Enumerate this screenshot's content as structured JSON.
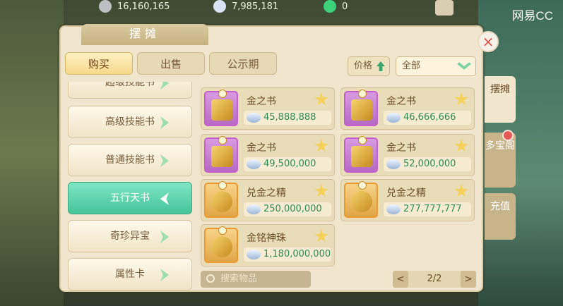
{
  "top_bar": {
    "resources": [
      {
        "icon": "coin-icon",
        "value": "16,160,165"
      },
      {
        "icon": "silver-icon",
        "value": "7,985,181"
      },
      {
        "icon": "plus-icon",
        "value": "0"
      }
    ],
    "brand": "网易CC",
    "badge_icon": "points-badge-icon"
  },
  "panel": {
    "title": "摆摊",
    "tabs": [
      {
        "label": "购买",
        "active": true
      },
      {
        "label": "出售",
        "active": false
      },
      {
        "label": "公示期",
        "active": false
      }
    ],
    "price_sort_label": "价格",
    "filter_value": "全部",
    "categories": [
      {
        "label": "超级技能书",
        "active": false
      },
      {
        "label": "高级技能书",
        "active": false
      },
      {
        "label": "普通技能书",
        "active": false
      },
      {
        "label": "五行天书",
        "active": true
      },
      {
        "label": "奇珍异宝",
        "active": false
      },
      {
        "label": "属性卡",
        "active": false
      }
    ],
    "items": [
      {
        "name": "金之书",
        "price": "45,888,888",
        "icon": "golden-book-icon",
        "frame": "purple"
      },
      {
        "name": "金之书",
        "price": "46,666,666",
        "icon": "golden-book-icon",
        "frame": "purple"
      },
      {
        "name": "金之书",
        "price": "49,500,000",
        "icon": "golden-book-icon",
        "frame": "purple"
      },
      {
        "name": "金之书",
        "price": "52,000,000",
        "icon": "golden-book-icon",
        "frame": "purple"
      },
      {
        "name": "兑金之精",
        "price": "250,000,000",
        "icon": "gold-essence-icon",
        "frame": "orange"
      },
      {
        "name": "兑金之精",
        "price": "277,777,777",
        "icon": "gold-essence-icon",
        "frame": "orange"
      },
      {
        "name": "金铭神珠",
        "price": "1,180,000,000",
        "icon": "divine-pearl-icon",
        "frame": "orange"
      }
    ],
    "search_placeholder": "搜索物品",
    "page_info": "2/2",
    "prev_label": "<",
    "next_label": ">"
  },
  "side_tabs": [
    {
      "label": "摆摊",
      "active": true
    },
    {
      "label": "多宝阁",
      "active": false
    },
    {
      "label": "充值",
      "active": false
    }
  ],
  "colors": {
    "active_category": "#45c49a",
    "price_text": "#2f8a52",
    "close_x": "#d9504a",
    "panel_bg": "#efe6cd"
  }
}
